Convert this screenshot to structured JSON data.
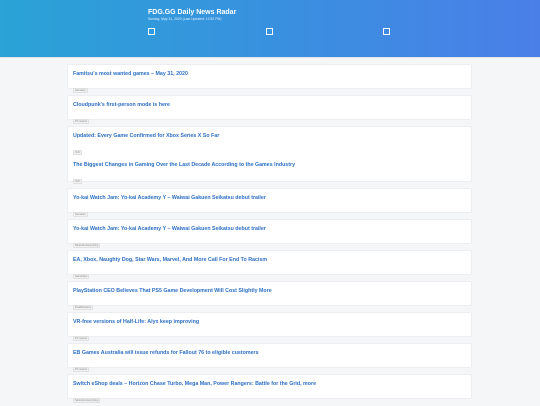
{
  "header": {
    "title": "FDG.GG Daily News Radar",
    "subtitle": "Sunday, May 31, 2020 (Last Updated: 12:52 PM)",
    "accent_start": "#2aa3d6",
    "accent_end": "#4a7fe8"
  },
  "articles": [
    {
      "headline": "Famitsu's most wanted games – May 31, 2020",
      "source": "Gematsu"
    },
    {
      "headline": "Cloudpunk's first-person mode is here",
      "source": "PC Gamer"
    },
    {
      "headline": "Updated: Every Game Confirmed for Xbox Series X So Far",
      "source": "IGN"
    },
    {
      "headline": "The Biggest Changes in Gaming Over the Last Decade According to the Games Industry",
      "source": "IGN"
    },
    {
      "headline": "Yo-kai Watch Jam: Yo-kai Academy Y – Waiwai Gakuen Seikatsu debut trailer",
      "source": "Gematsu"
    },
    {
      "headline": "Yo-kai Watch Jam: Yo-kai Academy Y – Waiwai Gakuen Seikatsu debut trailer",
      "source": "Nintendo Everything"
    },
    {
      "headline": "EA, Xbox, Naughty Dog, Star Wars, Marvel, And More Call For End To Racism",
      "source": "GameSpot"
    },
    {
      "headline": "PlayStation CEO Believes That PS5 Game Development Will Cost Slightly More",
      "source": "DualShockers"
    },
    {
      "headline": "VR-free versions of Half-Life: Alyx keep improving",
      "source": "PC Gamer"
    },
    {
      "headline": "EB Games Australia will issue refunds for Fallout 76 to eligible customers",
      "source": "PC Gamer"
    },
    {
      "headline": "Switch eShop deals – Horizon Chase Turbo, Mega Man, Power Rangers: Battle for the Grid, more",
      "source": "Nintendo Everything"
    }
  ]
}
